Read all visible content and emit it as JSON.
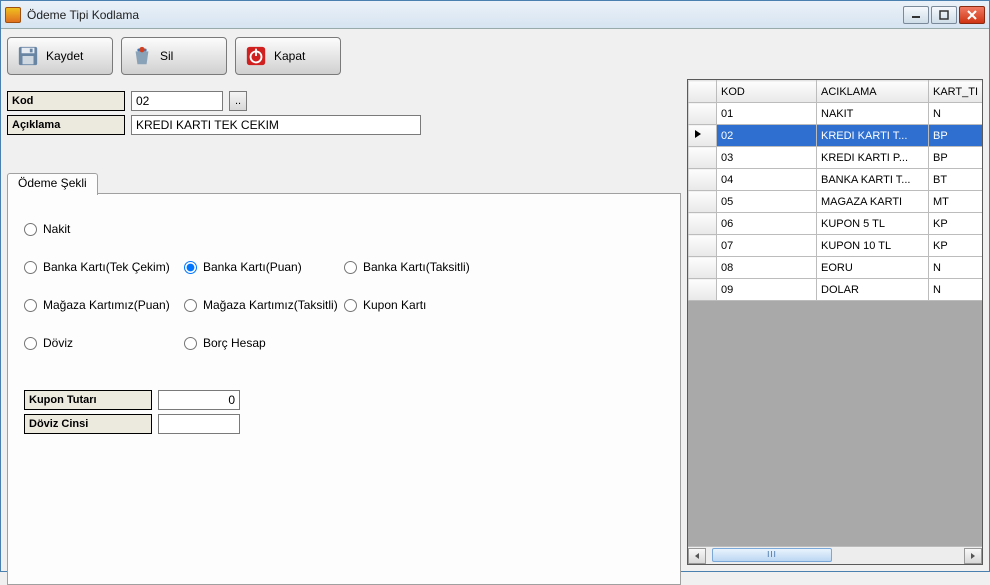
{
  "titlebar": {
    "title": "Ödeme Tipi Kodlama"
  },
  "toolbar": {
    "save_label": "Kaydet",
    "delete_label": "Sil",
    "close_label": "Kapat"
  },
  "form": {
    "kod_label": "Kod",
    "kod_value": "02",
    "lookup_label": "..",
    "aciklama_label": "Açıklama",
    "aciklama_value": "KREDI KARTI TEK CEKIM"
  },
  "tab": {
    "label": "Ödeme Şekli"
  },
  "radios": {
    "nakit": "Nakit",
    "banka_tek": "Banka Kartı(Tek Çekim)",
    "banka_puan": "Banka Kartı(Puan)",
    "banka_taksit": "Banka Kartı(Taksitli)",
    "magaza_puan": "Mağaza Kartımız(Puan)",
    "magaza_taksit": "Mağaza Kartımız(Taksitli)",
    "kupon": "Kupon Kartı",
    "doviz": "Döviz",
    "borc": "Borç Hesap",
    "selected": "banka_puan"
  },
  "subform": {
    "kupon_label": "Kupon Tutarı",
    "kupon_value": "0",
    "doviz_label": "Döviz Cinsi",
    "doviz_value": ""
  },
  "grid": {
    "headers": {
      "sel": "",
      "kod": "KOD",
      "aciklama": "ACIKLAMA",
      "kart": "KART_TI"
    },
    "rows": [
      {
        "kod": "01",
        "aciklama": "NAKIT",
        "kart": "N",
        "selected": false
      },
      {
        "kod": "02",
        "aciklama": "KREDI KARTI T...",
        "kart": "BP",
        "selected": true
      },
      {
        "kod": "03",
        "aciklama": "KREDI KARTI  P...",
        "kart": "BP",
        "selected": false
      },
      {
        "kod": "04",
        "aciklama": "BANKA KARTI T...",
        "kart": "BT",
        "selected": false
      },
      {
        "kod": "05",
        "aciklama": "MAGAZA KARTI",
        "kart": "MT",
        "selected": false
      },
      {
        "kod": "06",
        "aciklama": "KUPON 5 TL",
        "kart": "KP",
        "selected": false
      },
      {
        "kod": "07",
        "aciklama": "KUPON 10 TL",
        "kart": "KP",
        "selected": false
      },
      {
        "kod": "08",
        "aciklama": "EORU",
        "kart": "N",
        "selected": false
      },
      {
        "kod": "09",
        "aciklama": "DOLAR",
        "kart": "N",
        "selected": false
      }
    ]
  },
  "scroll_thumb": "III"
}
